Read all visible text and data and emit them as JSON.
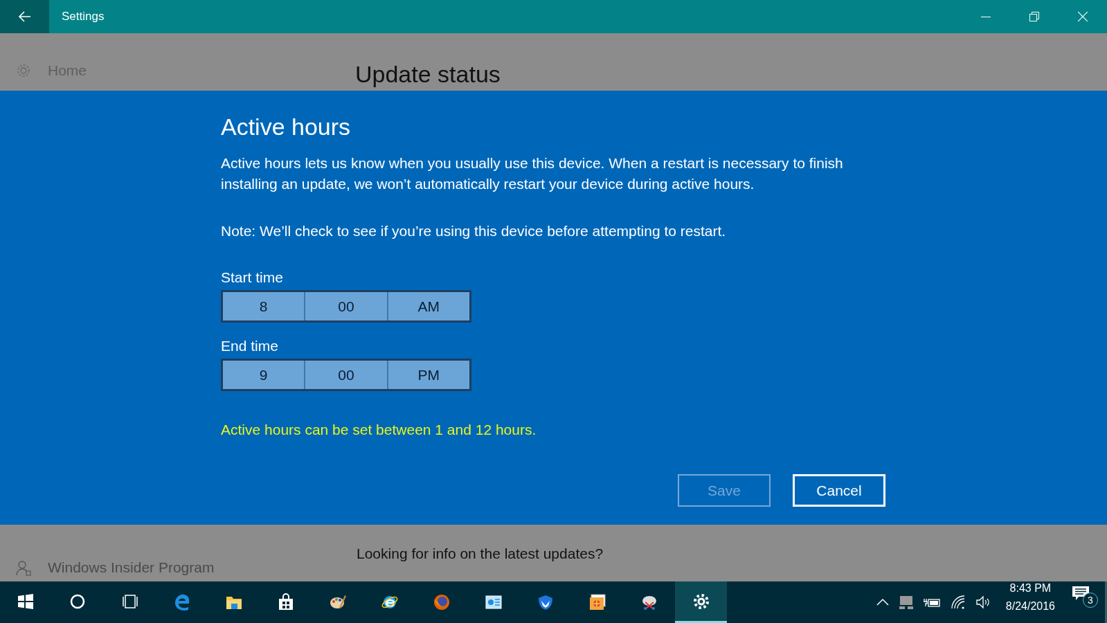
{
  "window": {
    "title": "Settings"
  },
  "sidebar": {
    "items": [
      {
        "label": "Home",
        "kind": "gear"
      },
      {
        "label": "Windows Insider Program",
        "kind": "person"
      }
    ]
  },
  "page": {
    "heading": "Update status",
    "section_heading": "Looking for info on the latest updates?"
  },
  "dialog": {
    "title": "Active hours",
    "description": "Active hours lets us know when you usually use this device. When a restart is necessary to finish installing an update, we won’t automatically restart your device during active hours.",
    "note": "Note: We’ll check to see if you’re using this device before attempting to restart.",
    "pickers": [
      {
        "label": "Start time",
        "hour": "8",
        "minute": "00",
        "period": "AM"
      },
      {
        "label": "End time",
        "hour": "9",
        "minute": "00",
        "period": "PM"
      }
    ],
    "warning": "Active hours can be set between 1 and 12 hours.",
    "buttons": [
      {
        "label": "Save",
        "disabled": true
      },
      {
        "label": "Cancel",
        "disabled": false
      }
    ]
  },
  "taskbar": {
    "apps": [
      {
        "kind": "start",
        "active": false
      },
      {
        "kind": "search",
        "active": false
      },
      {
        "kind": "taskview",
        "active": false
      },
      {
        "kind": "edge",
        "active": false
      },
      {
        "kind": "folder",
        "active": false
      },
      {
        "kind": "store",
        "active": false
      },
      {
        "kind": "paint",
        "active": false
      },
      {
        "kind": "ie",
        "active": false
      },
      {
        "kind": "firefox",
        "active": false
      },
      {
        "kind": "panel",
        "active": false
      },
      {
        "kind": "malware",
        "active": false
      },
      {
        "kind": "photos",
        "active": false
      },
      {
        "kind": "snip",
        "active": false
      },
      {
        "kind": "settings",
        "active": true
      }
    ],
    "time": "8:43 PM",
    "date": "8/24/2016",
    "notification_count": "3"
  }
}
